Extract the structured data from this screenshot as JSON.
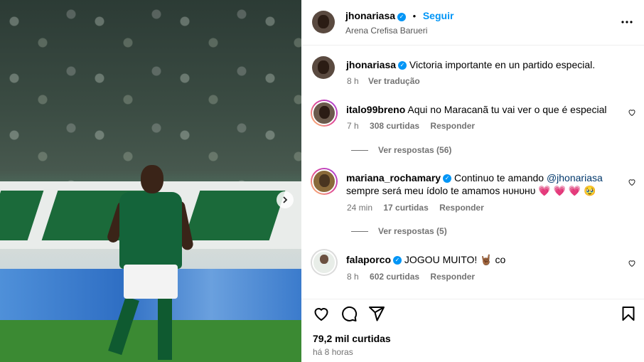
{
  "post": {
    "author": "jhonariasa",
    "follow_label": "Seguir",
    "location": "Arena Crefisa Barueri",
    "caption": "Victoria importante en un partido especial.",
    "caption_time": "8 h",
    "translate_label": "Ver tradução",
    "likes": "79,2 mil curtidas",
    "posted_ago": "há 8 horas"
  },
  "comments": [
    {
      "user": "italo99breno",
      "text": "Aqui no Maracanã tu vai ver o que é especial",
      "time": "7 h",
      "likes": "308 curtidas",
      "reply_label": "Responder",
      "view_replies": "Ver respostas (56)",
      "verified": false
    },
    {
      "user": "mariana_rochamary",
      "text": "Continuo te amando",
      "mention": "@jhonariasa",
      "text_line2": "sempre será meu ídolo te amamos ʜᴜʜᴜʜᴜ",
      "emojis": "💗 💗 💗 🥹",
      "time": "24 min",
      "likes": "17 curtidas",
      "reply_label": "Responder",
      "view_replies": "Ver respostas (5)",
      "verified": true
    },
    {
      "user": "falaporco",
      "text": "JOGOU MUITO! 🤘🏾 co",
      "time": "8 h",
      "likes": "602 curtidas",
      "reply_label": "Responder",
      "verified": true
    }
  ],
  "colors": {
    "accent": "#0095f6",
    "muted": "#737373",
    "text": "#000000"
  },
  "icons": [
    "more-options-icon",
    "heart-icon",
    "comment-icon",
    "share-icon",
    "bookmark-icon",
    "verified-icon",
    "chevron-right-icon"
  ]
}
